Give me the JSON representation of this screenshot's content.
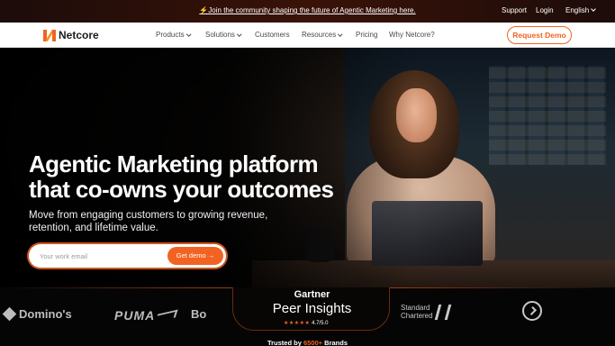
{
  "announcement": {
    "text": "⚡Join the community shaping the future of Agentic Marketing here."
  },
  "utility_links": {
    "support": "Support",
    "login": "Login",
    "language": "English"
  },
  "nav": {
    "logo_text": "Netcore",
    "items": [
      {
        "label": "Products",
        "has_dropdown": true
      },
      {
        "label": "Solutions",
        "has_dropdown": true
      },
      {
        "label": "Customers",
        "has_dropdown": false
      },
      {
        "label": "Resources",
        "has_dropdown": true
      },
      {
        "label": "Pricing",
        "has_dropdown": false
      },
      {
        "label": "Why Netcore?",
        "has_dropdown": false
      }
    ],
    "cta": "Request Demo"
  },
  "hero": {
    "title": "Agentic Marketing platform that co-owns your outcomes",
    "subtitle": "Move from engaging customers to growing revenue, retention, and lifetime value.",
    "email_placeholder": "Your work email",
    "button": "Get demo →"
  },
  "logos": {
    "dominos": "Domino's",
    "puma": "PUMA",
    "bo": "Bo",
    "standard_chartered": [
      "Standard",
      "Chartered"
    ],
    "skoda": "skoda-logo"
  },
  "peer_insights": {
    "brand": "Gartner",
    "product": "Peer Insights",
    "stars": "★★★★★",
    "rating": "4.7/5.0"
  },
  "trusted": {
    "prefix": "Trusted by",
    "count": "6500+",
    "suffix": "Brands"
  },
  "colors": {
    "accent": "#f26322",
    "announcement_bg": "#2a0f0a",
    "nav_bg": "#ffffff"
  }
}
